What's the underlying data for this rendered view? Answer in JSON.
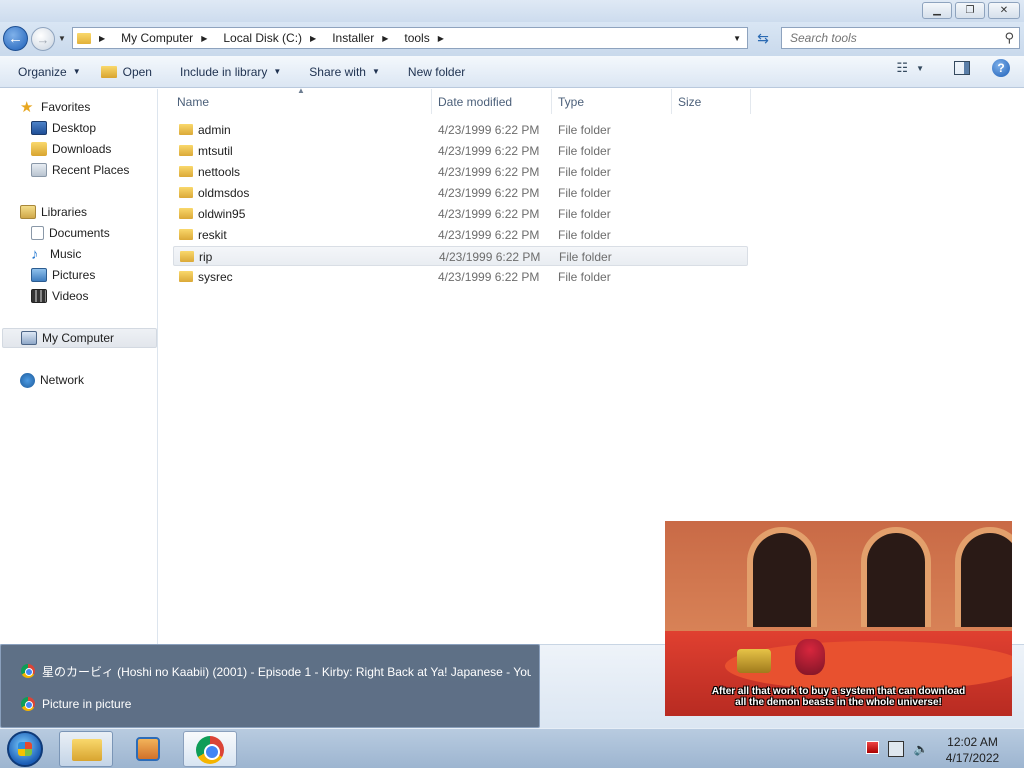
{
  "addressbar": {
    "crumbs": [
      "My Computer",
      "Local Disk (C:)",
      "Installer",
      "tools"
    ],
    "search_placeholder": "Search tools"
  },
  "toolbar": {
    "organize": "Organize",
    "open": "Open",
    "include": "Include in library",
    "share": "Share with",
    "newfolder": "New folder"
  },
  "navpane": {
    "favorites": "Favorites",
    "desktop": "Desktop",
    "downloads": "Downloads",
    "recent": "Recent Places",
    "libraries": "Libraries",
    "documents": "Documents",
    "music": "Music",
    "pictures": "Pictures",
    "videos": "Videos",
    "mycomputer": "My Computer",
    "network": "Network"
  },
  "columns": {
    "name": "Name",
    "date": "Date modified",
    "type": "Type",
    "size": "Size"
  },
  "files": [
    {
      "name": "admin",
      "date": "4/23/1999 6:22 PM",
      "type": "File folder"
    },
    {
      "name": "mtsutil",
      "date": "4/23/1999 6:22 PM",
      "type": "File folder"
    },
    {
      "name": "nettools",
      "date": "4/23/1999 6:22 PM",
      "type": "File folder"
    },
    {
      "name": "oldmsdos",
      "date": "4/23/1999 6:22 PM",
      "type": "File folder"
    },
    {
      "name": "oldwin95",
      "date": "4/23/1999 6:22 PM",
      "type": "File folder"
    },
    {
      "name": "reskit",
      "date": "4/23/1999 6:22 PM",
      "type": "File folder"
    },
    {
      "name": "rip",
      "date": "4/23/1999 6:22 PM",
      "type": "File folder"
    },
    {
      "name": "sysrec",
      "date": "4/23/1999 6:22 PM",
      "type": "File folder"
    }
  ],
  "popup": {
    "item1": "星のカービィ (Hoshi no Kaabii) (2001) - Episode 1 - Kirby: Right Back at Ya! Japanese - You...",
    "item2": "Picture in picture"
  },
  "pip": {
    "subtitle_line1": "After all that work to buy a system that can download",
    "subtitle_line2": "all the demon beasts in the whole universe!"
  },
  "clock": {
    "time": "12:02 AM",
    "date": "4/17/2022"
  }
}
